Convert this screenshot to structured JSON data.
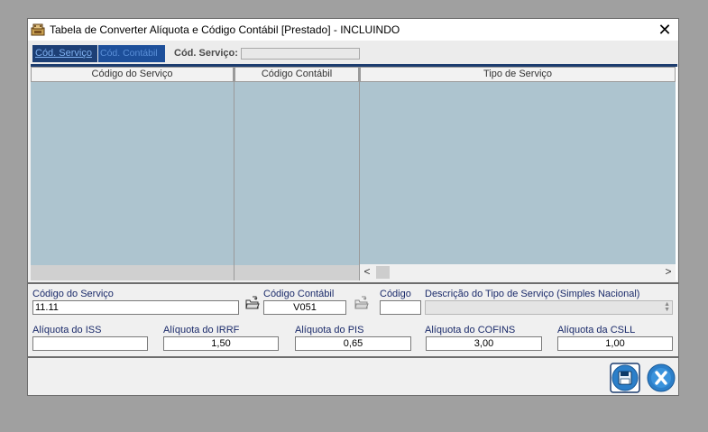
{
  "window": {
    "title": "Tabela de Converter Alíquota e Código Contábil [Prestado]  -   INCLUINDO",
    "close_glyph": "✕"
  },
  "toolbar": {
    "tab_servico": "Cód. Serviço",
    "tab_contabil": "Cód. Contábil",
    "search_label": "Cód. Serviço:",
    "search_value": ""
  },
  "grid": {
    "columns": [
      "Código do Serviço",
      "Código Contábil",
      "Tipo de Serviço"
    ],
    "rows": [],
    "scroll_left": "<",
    "scroll_right": ">"
  },
  "form": {
    "codigo_servico": {
      "label": "Código do Serviço",
      "value": "11.11"
    },
    "codigo_contabil": {
      "label": "Código Contábil",
      "value": "V051"
    },
    "codigo": {
      "label": "Código",
      "value": ""
    },
    "descricao": {
      "label": "Descrição do Tipo de Serviço (Simples Nacional)",
      "value": ""
    },
    "aliq_iss": {
      "label": "Alíquota do ISS",
      "value": ""
    },
    "aliq_irrf": {
      "label": "Alíquota do IRRF",
      "value": "1,50"
    },
    "aliq_pis": {
      "label": "Alíquota do PIS",
      "value": "0,65"
    },
    "aliq_cofins": {
      "label": "Alíquota do COFINS",
      "value": "3,00"
    },
    "aliq_csll": {
      "label": "Alíquota da CSLL",
      "value": "1,00"
    }
  },
  "icons": {
    "app": "app-icon",
    "lookup_servico": "lookup-folder-icon",
    "lookup_contabil": "lookup-folder-icon",
    "save": "save-icon",
    "cancel": "cancel-icon"
  },
  "colors": {
    "grid_background": "#adc4cf",
    "accent_dark_blue": "#1c3c6e",
    "label_blue": "#1a2a6a",
    "button_blue": "#2c7fc9"
  }
}
